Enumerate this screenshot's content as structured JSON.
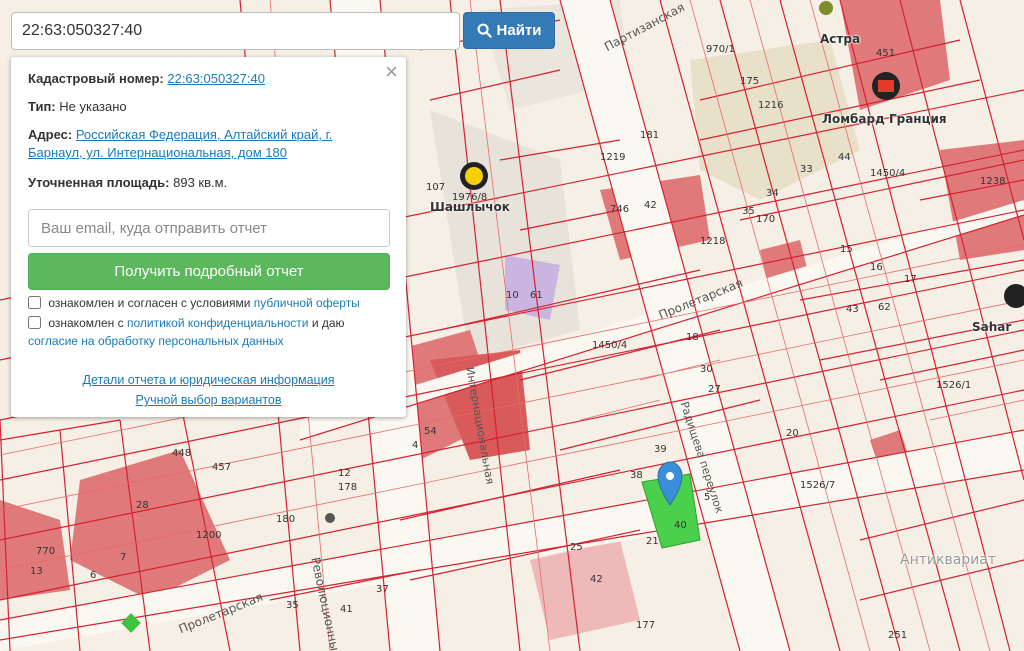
{
  "search": {
    "value": "22:63:050327:40",
    "button_label": "Найти"
  },
  "info": {
    "cadastral_label": "Кадастровый номер:",
    "cadastral_value": "22:63:050327:40",
    "type_label": "Тип:",
    "type_value": "Не указано",
    "address_label": "Адрес:",
    "address_value": "Российская Федерация, Алтайский край, г. Барнаул, ул. Интернациональная, дом 180",
    "area_label": "Уточненная площадь:",
    "area_value": "893 кв.м.",
    "close_symbol": "×"
  },
  "form": {
    "email_placeholder": "Ваш email, куда отправить отчет",
    "report_button": "Получить подробный отчет",
    "check1_prefix": "ознакомлен и согласен с условиями",
    "check1_link": "публичной оферты",
    "check2_prefix": "ознакомлен с",
    "check2_link": "политикой конфиденциальности",
    "check2_middle": "и даю",
    "check2_link2": "согласие на обработку персональных данных"
  },
  "footer": {
    "details_link": "Детали отчета и юридическая информация",
    "manual_link": "Ручной выбор вариантов"
  },
  "map": {
    "streets": [
      "Партизанская",
      "Пролетарская",
      "Пролетарская",
      "Революционный",
      "Интернациональная",
      "Радищева переулок"
    ],
    "pois": [
      "Астра",
      "Ломбард Гранция",
      "Шашлычок",
      "Sahar",
      "Антиквариат"
    ],
    "plots": [
      "970/1",
      "175",
      "1216",
      "451",
      "181",
      "746",
      "42",
      "1219",
      "1976/8",
      "107",
      "1218",
      "170",
      "35",
      "34",
      "33",
      "44",
      "1450/4",
      "10",
      "61",
      "1450/4",
      "27",
      "18",
      "30",
      "39",
      "38",
      "5",
      "40",
      "178",
      "180",
      "12",
      "457",
      "448",
      "28",
      "1200",
      "7",
      "770",
      "13",
      "37",
      "41",
      "35",
      "1526/1",
      "1526/7",
      "20",
      "62",
      "1238",
      "54",
      "4",
      "15",
      "16",
      "17",
      "43",
      "25",
      "42",
      "177",
      "251",
      "21",
      "6"
    ],
    "colors": {
      "boundary": "#d6202f",
      "plot_fill": "#f0b9b9",
      "building": "#e07a7a",
      "selected": "#4bd04b",
      "marker": "#3a8fd9"
    }
  }
}
